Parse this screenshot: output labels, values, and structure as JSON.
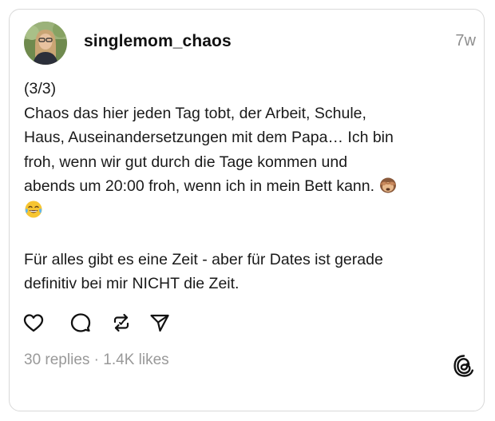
{
  "post": {
    "username": "singlemom_chaos",
    "timestamp": "7w",
    "lines": {
      "part": "(3/3)",
      "p1_a": "Chaos das hier jeden Tag tobt, der Arbeit, Schule,",
      "p1_b": "Haus, Auseinandersetzungen mit dem Papa… Ich bin",
      "p1_c": "froh, wenn wir gut durch die Tage kommen und",
      "p1_d": "abends um 20:00 froh, wenn ich in mein Bett kann.",
      "p2_a": "Für alles gibt es eine Zeit - aber für Dates ist gerade",
      "p2_b": "definitiv bei mir NICHT die Zeit."
    },
    "emojis": [
      "see-no-evil-monkey",
      "face-with-tears-of-joy"
    ]
  },
  "actions": {
    "icons": [
      "heart-icon",
      "comment-icon",
      "repost-icon",
      "share-icon"
    ]
  },
  "stats": {
    "replies": "30 replies",
    "separator": " · ",
    "likes": "1.4K likes"
  },
  "brand": {
    "logo": "threads-logo-icon"
  }
}
